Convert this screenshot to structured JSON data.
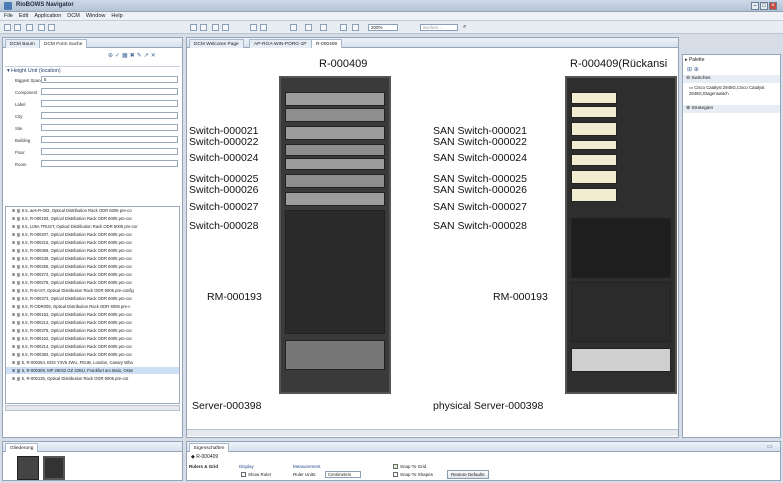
{
  "window": {
    "title": "RioBOWS Navigator"
  },
  "menu": [
    "File",
    "Edit",
    "Application",
    "DCM",
    "Window",
    "Help"
  ],
  "left_panel": {
    "tabs": [
      "DCM Baum",
      "DCM Form Suche"
    ],
    "section_title": "Height Unit (location)",
    "fields": [
      {
        "label": "Biggest Space",
        "value": "5"
      },
      {
        "label": "Component",
        "value": ""
      },
      {
        "label": "Label",
        "value": ""
      },
      {
        "label": "City",
        "value": ""
      },
      {
        "label": "Site",
        "value": ""
      },
      {
        "label": "Building",
        "value": ""
      },
      {
        "label": "Floor",
        "value": ""
      },
      {
        "label": "Room",
        "value": ""
      }
    ],
    "results": [
      "6.5, aes-R-002, Optical Distribution Rack ODR 6005 pre-co",
      "6.5, R-000193, Optical Distribution Rack ODR 6005 pre-cor",
      "6.5, L05A TRUST, Optical Distribution Rack ODR 6005 pre-cor",
      "6.5, R-000207, Optical Distribution Rack ODR 6005 pre-cor",
      "6.5, R-000215, Optical Distribution Rack ODR 6005 pre-cor",
      "6.5, R-000369, Optical Distribution Rack ODR 6005 pre-cor",
      "6.5, R-000239, Optical Distribution Rack ODR 6005 pre-cor",
      "6.5, R-000256, Optical Distribution Rack ODR 6005 pre-cor",
      "6.5, R-000274, Optical Distribution Rack ODR 6005 pre-cor",
      "6.5, R-000276, Optical Distribution Rack ODR 6005 pre-cor",
      "6.5, R-EAST, Optical Distribution Rack ODR 6005 pre-config",
      "6.5, R-000373, Optical Distribution Rack ODR 6005 pre-cor",
      "6.5, R-ODR005, Optical Distribution Rack ODR 6005 pre-c",
      "6.5, R-000153, Optical Distribution Rack ODR 6005 pre-cor",
      "6.5, R-000213, Optical Distribution Rack ODR 6005 pre-cor",
      "6.5, R-000375, Optical Distribution Rack ODR 6005 pre-cor",
      "6.5, R-000152, Optical Distribution Rack ODR 6005 pre-cor",
      "6.5, R-000214, Optical Distribution Rack ODR 6005 pre-cor",
      "6.5, R-000384, Optical Distribution Rack ODR 6005 pre-cor",
      "5, R-000254, EDS Y3V6 JWU, FEUB, London, Canary Wha",
      "5, R-000409, MP 28042 GZ 42BU, Frankfurt am Main, Ostw",
      "5, R-000135, Optical Distribution Rack ODR 6005 pre-cor"
    ]
  },
  "editor": {
    "tabs": [
      "DCM Welcome Page",
      "AP-RGA-WIN-PORG-1P",
      "R-000409"
    ],
    "rack_front_title": "R-000409",
    "rack_back_title": "R-000409(Rückansi",
    "front_labels": [
      "Switch-000021",
      "Switch-000022",
      "Switch-000024",
      "Switch-000025",
      "Switch-000026",
      "Switch-000027",
      "Switch-000028",
      "RM-000193",
      "Server-000398"
    ],
    "back_labels": [
      "SAN Switch-000021",
      "SAN Switch-000022",
      "SAN Switch-000024",
      "SAN Switch-000025",
      "SAN Switch-000026",
      "SAN Switch-000027",
      "SAN Switch-000028",
      "RM-000193",
      "physical Server-000398"
    ],
    "zoom": "200%",
    "search_placeholder": "Suchen..."
  },
  "palette": {
    "title": "Palette",
    "switches_header": "Switches",
    "switch_item": "Cisco Catalyst 2948G,Cisco Catalyst 2948G,Etagenswitch",
    "strategies": "Strategien"
  },
  "overview": {
    "title": "Gliederung"
  },
  "properties": {
    "title": "Eigenschaften",
    "object": "R-000409",
    "side_tab": "Rulers & Grid",
    "display_group": "Display",
    "show_ruler": "Show Ruler",
    "show_grid": "Show Grid",
    "grid_in_front": "Grid In Front",
    "measurement_group": "Measurement",
    "ruler_units_label": "Ruler Units:",
    "ruler_units_value": "Centimeters",
    "grid_spacing_label": "Grid Spacing:",
    "grid_spacing_value": "0.125",
    "gridline_group": "Grid Line",
    "color_label": "Color:",
    "style_label": "Style:",
    "style_value": "Spaced Dot",
    "snap_to_grid": "Snap To Grid",
    "snap_to_shapes": "Snap To Shapes",
    "restore_defaults": "Restore Defaults"
  }
}
